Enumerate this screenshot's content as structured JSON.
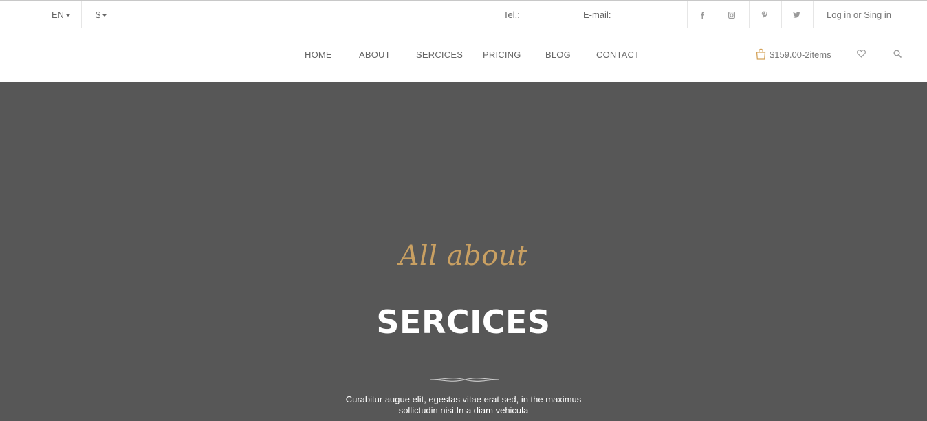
{
  "topbar": {
    "language": "EN",
    "currency": "$",
    "tel_label": "Tel.:",
    "email_label": "E-mail:",
    "social": [
      "facebook-icon",
      "instagram-icon",
      "pinterest-icon",
      "twitter-icon"
    ],
    "login_text": "Log in or Sing in"
  },
  "nav": {
    "items": [
      "HOME",
      "ABOUT",
      "SERCICES",
      "PRICING",
      "BLOG",
      "CONTACT"
    ],
    "cart_text": "$159.00-2items",
    "icons": [
      "shopping-bag-icon",
      "heart-icon",
      "search-icon"
    ]
  },
  "hero": {
    "script_text": "All about",
    "title": "SERCICES",
    "description_line1": "Curabitur augue elit, egestas vitae erat sed, in the maximus",
    "description_line2": "sollictudin nisi.In a diam vehicula"
  },
  "colors": {
    "accent": "#c9a062",
    "hero_bg": "#575757",
    "text": "#666666"
  }
}
